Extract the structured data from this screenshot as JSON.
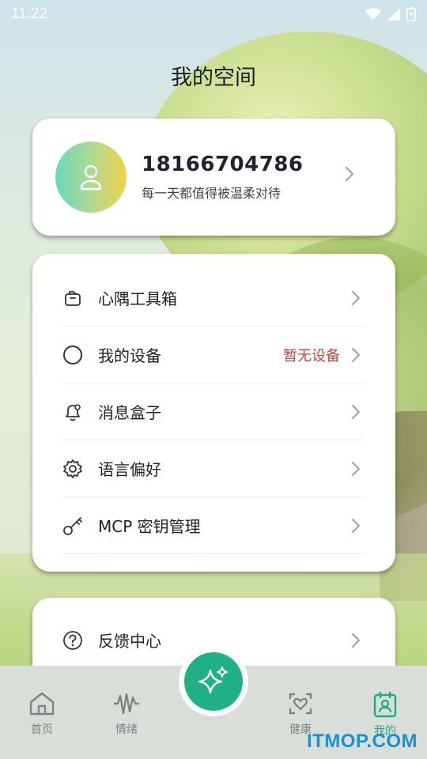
{
  "status": {
    "time": "11:22"
  },
  "page": {
    "title": "我的空间"
  },
  "profile": {
    "phone": "18166704786",
    "motto": "每一天都值得被温柔对待"
  },
  "menu": {
    "items": [
      {
        "label": "心隅工具箱",
        "icon": "toolbox-icon"
      },
      {
        "label": "我的设备",
        "icon": "circle-icon",
        "extra": "暂无设备"
      },
      {
        "label": "消息盒子",
        "icon": "bell-icon"
      },
      {
        "label": "语言偏好",
        "icon": "gear-icon"
      },
      {
        "label": "MCP 密钥管理",
        "icon": "key-icon"
      }
    ]
  },
  "support": {
    "label": "反馈中心",
    "icon": "help-icon"
  },
  "tabbar": {
    "tabs": [
      {
        "label": "首页",
        "icon": "home-icon"
      },
      {
        "label": "情绪",
        "icon": "wave-icon"
      },
      {
        "label": "健康",
        "icon": "heart-frame-icon"
      },
      {
        "label": "我的",
        "icon": "profile-badge-icon",
        "active": true
      }
    ],
    "fab_icon": "sparkle-icon"
  },
  "colors": {
    "accent": "#1fb083",
    "warning_text": "#c4453e",
    "active_tab": "#1faa86"
  },
  "watermark": "ITMOP.COM"
}
